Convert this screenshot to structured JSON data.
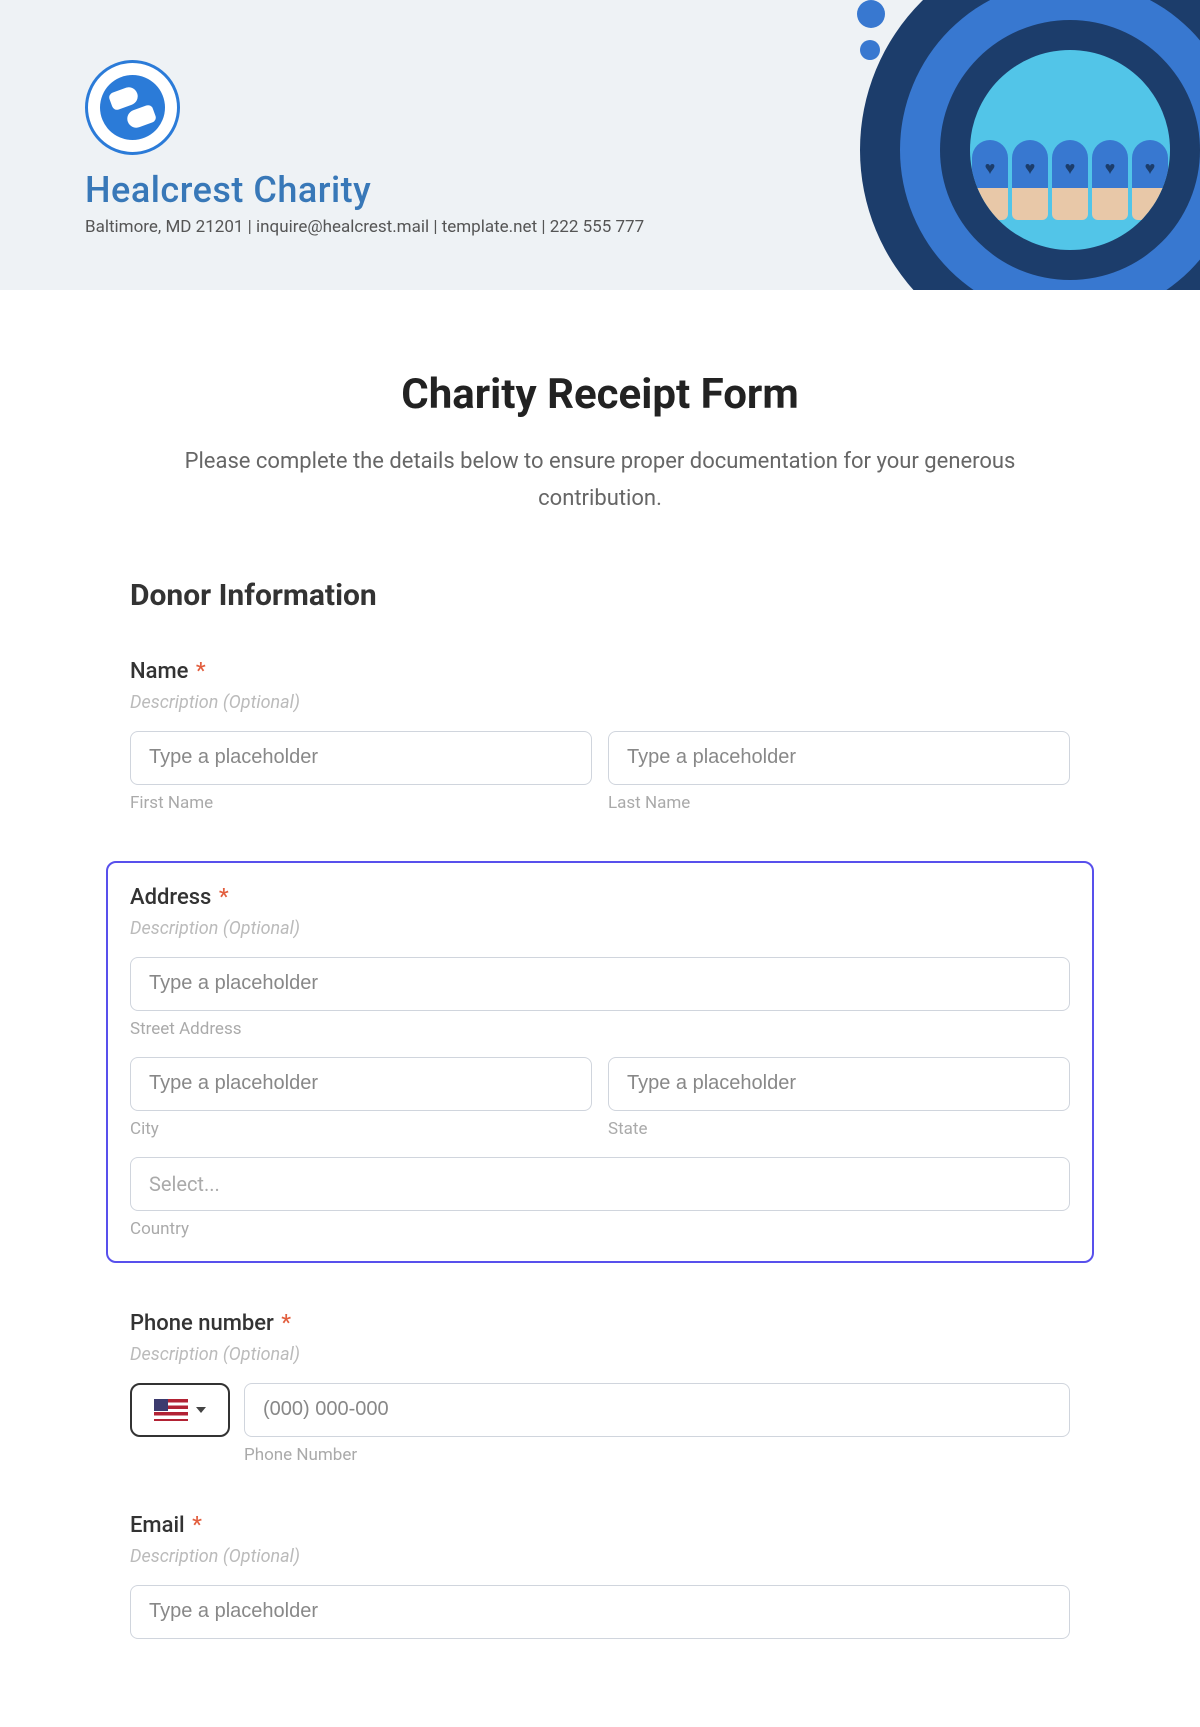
{
  "header": {
    "org_name": "Healcrest Charity",
    "meta": "Baltimore, MD 21201 | inquire@healcrest.mail | template.net | 222 555 777"
  },
  "form": {
    "title": "Charity Receipt Form",
    "intro": "Please complete the details below to ensure proper documentation for your generous contribution.",
    "section_donor": "Donor Information",
    "fields": {
      "name": {
        "label": "Name",
        "desc": "Description (Optional)",
        "first_placeholder": "Type a placeholder",
        "last_placeholder": "Type a placeholder",
        "first_sublabel": "First Name",
        "last_sublabel": "Last Name"
      },
      "address": {
        "label": "Address",
        "desc": "Description (Optional)",
        "street_placeholder": "Type a placeholder",
        "street_sublabel": "Street Address",
        "city_placeholder": "Type a placeholder",
        "city_sublabel": "City",
        "state_placeholder": "Type a placeholder",
        "state_sublabel": "State",
        "country_placeholder": "Select...",
        "country_sublabel": "Country"
      },
      "phone": {
        "label": "Phone number",
        "desc": "Description (Optional)",
        "placeholder": "(000) 000-000",
        "sublabel": "Phone Number"
      },
      "email": {
        "label": "Email",
        "desc": "Description (Optional)",
        "placeholder": "Type a placeholder"
      }
    }
  }
}
